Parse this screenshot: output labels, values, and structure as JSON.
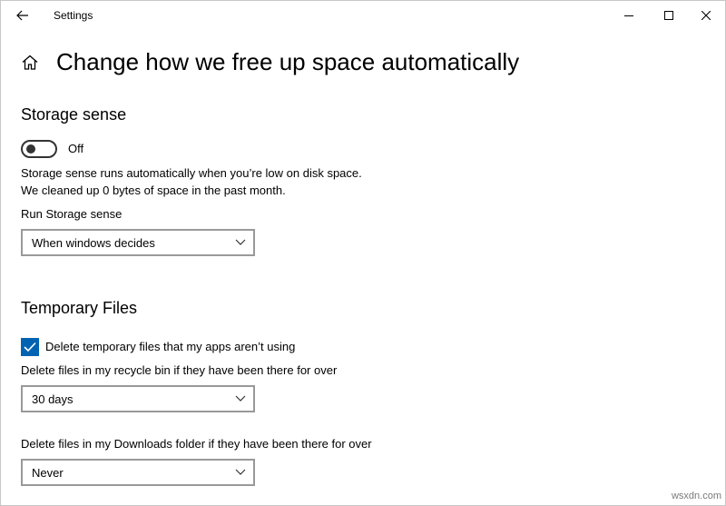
{
  "window": {
    "title": "Settings"
  },
  "page": {
    "title": "Change how we free up space automatically"
  },
  "storage_sense": {
    "heading": "Storage sense",
    "toggle_state": "Off",
    "description_line1": "Storage sense runs automatically when you’re low on disk space.",
    "description_line2": "We cleaned up 0 bytes of space in the past month.",
    "run_label": "Run Storage sense",
    "run_value": "When windows decides"
  },
  "temporary_files": {
    "heading": "Temporary Files",
    "delete_temp_label": "Delete temporary files that my apps aren’t using",
    "delete_temp_checked": true,
    "recycle_label": "Delete files in my recycle bin if they have been there for over",
    "recycle_value": "30 days",
    "downloads_label": "Delete files in my Downloads folder if they have been there for over",
    "downloads_value": "Never"
  },
  "watermark": "wsxdn.com",
  "colors": {
    "accent": "#0063b1",
    "border": "#999999",
    "toggle": "#333333"
  },
  "icons": {
    "back": "back-arrow-icon",
    "minimize": "minimize-icon",
    "maximize": "maximize-icon",
    "close": "close-icon",
    "home": "home-icon",
    "chevron": "chevron-down-icon",
    "check": "checkmark-icon"
  }
}
